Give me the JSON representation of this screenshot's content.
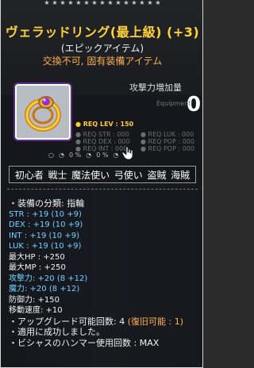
{
  "header": {
    "stars": 15,
    "title": "ヴェラッドリング(最上級) (+3)",
    "subtitle": "(エピックアイテム)",
    "trade_info": "交換不可, 固有装備アイテム"
  },
  "item_icon": {
    "name": "ring-icon"
  },
  "attack_increase": {
    "label": "攻撃力増加量",
    "value": "0",
    "ghost": "Equipment"
  },
  "requirements": {
    "lev": "● REQ LEV : 150",
    "left": [
      "● REQ STR : 000",
      "● REQ DEX : 000",
      "● REQ INT : 000"
    ],
    "right": [
      "● REQ LUK : 000",
      "● REQ POP : 000",
      "● REQ POP : 000"
    ]
  },
  "icon_row": [
    "○",
    "◔",
    "0 %",
    "◔",
    "0 %",
    "◔"
  ],
  "jobs": [
    "初心者",
    "戦士",
    "魔法使い",
    "弓使い",
    "盗賊",
    "海賊"
  ],
  "stats": {
    "category": "・装備の分類: 指輪",
    "str": "STR : +19 (10 +9)",
    "dex": "DEX : +19 (10 +9)",
    "int": "INT : +19 (10 +9)",
    "luk": "LUK : +19 (10 +9)",
    "hp": "最大HP : +250",
    "mp": "最大MP : +250",
    "atk": "攻撃力: +20 (8 +12)",
    "matk": "魔力: +20 (8 +12)",
    "def": "防御力: +150",
    "speed": "移動速度: +10",
    "upgrade_label": "・アップグレード可能回数: 4",
    "upgrade_restore": "(復旧可能 : 1)",
    "upgrade_success": "・適用に成功しました。",
    "hammer": "・ビシャスのハンマー使用回数 : MAX"
  }
}
